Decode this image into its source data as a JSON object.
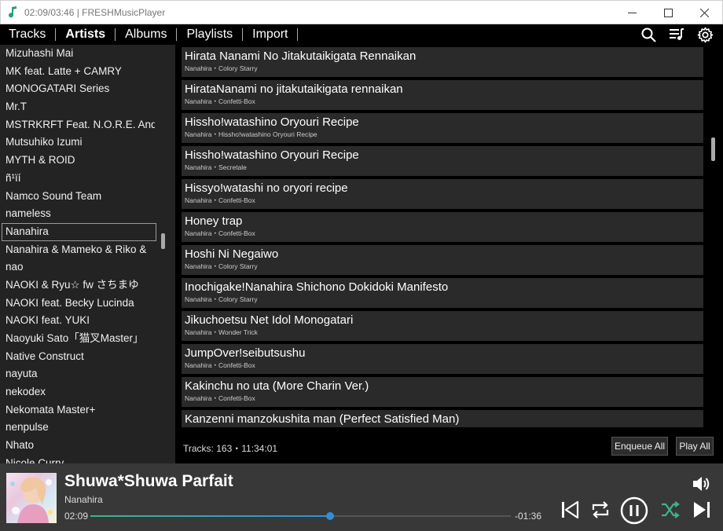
{
  "window": {
    "title": "02:09/03:46 | FRESHMusicPlayer"
  },
  "menu": {
    "tabs": [
      {
        "label": "Tracks",
        "active": false
      },
      {
        "label": "Artists",
        "active": true
      },
      {
        "label": "Albums",
        "active": false
      },
      {
        "label": "Playlists",
        "active": false
      },
      {
        "label": "Import",
        "active": false
      }
    ],
    "icons": [
      "search-icon",
      "queue-icon",
      "gear-icon"
    ]
  },
  "sidebar": {
    "artists": [
      "Mizuhashi Mai",
      "MK feat. Latte + CAMRY",
      "MONOGATARI Series",
      "Mr.T",
      "MSTRKRFT Feat. N.O.R.E. And I",
      "Mutsuhiko Izumi",
      "MYTH & ROID",
      "ñ¹ïí",
      "Namco Sound Team",
      "nameless",
      "Nanahira",
      "Nanahira & Mameko & Riko &",
      "nao",
      "NAOKI & Ryu☆ fw さちまゆ",
      "NAOKI feat. Becky Lucinda",
      "NAOKI feat. YUKI",
      "Naoyuki Sato「猫叉Master」",
      "Native Construct",
      "nayuta",
      "nekodex",
      "Nekomata Master+",
      "nenpulse",
      "Nhato",
      "Nicole Curry"
    ],
    "selected": "Nanahira"
  },
  "tracks": [
    {
      "title": "Hirata Nanami No Jitakutaikigata Rennaikan",
      "subtitle": "Nanahira・Colory Starry"
    },
    {
      "title": "HirataNanami no jitakutaikigata rennaikan",
      "subtitle": "Nanahira・Confetti-Box"
    },
    {
      "title": "Hissho!watashino Oryouri Recipe",
      "subtitle": "Nanahira・Hissho!watashino Oryouri Recipe"
    },
    {
      "title": "Hissho!watashino Oryouri Recipe",
      "subtitle": "Nanahira・Secretale"
    },
    {
      "title": "Hissyo!watashi no oryori recipe",
      "subtitle": "Nanahira・Confetti-Box"
    },
    {
      "title": "Honey trap",
      "subtitle": "Nanahira・Confetti-Box"
    },
    {
      "title": "Hoshi Ni Negaiwo",
      "subtitle": "Nanahira・Colory Starry"
    },
    {
      "title": "Inochigake!Nanahira Shichono Dokidoki Manifesto",
      "subtitle": "Nanahira・Colory Starry"
    },
    {
      "title": "Jikuchoetsu Net Idol Monogatari",
      "subtitle": "Nanahira・Wonder Trick"
    },
    {
      "title": "JumpOver!seibutsushu",
      "subtitle": "Nanahira・Confetti-Box"
    },
    {
      "title": "Kakinchu no uta (More Charin Ver.)",
      "subtitle": "Nanahira・Confetti-Box"
    },
    {
      "title": "Kanzenni manzokushita man (Perfect Satisfied Man)",
      "subtitle": ""
    }
  ],
  "footer": {
    "info": "Tracks: 163・11:34:01",
    "enqueue_label": "Enqueue All",
    "play_all_label": "Play All"
  },
  "player": {
    "title": "Shuwa*Shuwa Parfait",
    "artist": "Nanahira",
    "elapsed": "02:09",
    "remaining": "-01:36",
    "progress": 0.57,
    "colors": {
      "accent": "#2f8fd8",
      "shuffle": "#3fb48c"
    }
  }
}
